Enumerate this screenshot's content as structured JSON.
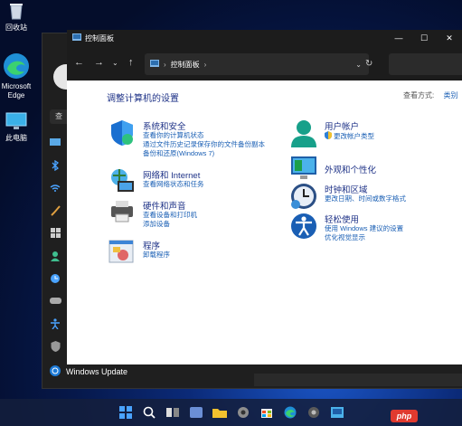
{
  "desktop": {
    "icons": [
      {
        "label": "回收站"
      },
      {
        "label": "Microsoft Edge"
      },
      {
        "label": "此电脑"
      }
    ]
  },
  "settings_window": {
    "search_text": "查",
    "footer_item": "Windows Update"
  },
  "control_panel": {
    "title": "控制面板",
    "address": {
      "crumb": "控制面板"
    },
    "heading": "调整计算机的设置",
    "view_by_label": "查看方式:",
    "view_by_value": "类别",
    "left_categories": [
      {
        "title": "系统和安全",
        "links": [
          "查看你的计算机状态",
          "通过文件历史记录保存你的文件备份副本",
          "备份和还原(Windows 7)"
        ]
      },
      {
        "title": "网络和 Internet",
        "links": [
          "查看网络状态和任务"
        ]
      },
      {
        "title": "硬件和声音",
        "links": [
          "查看设备和打印机",
          "添加设备"
        ]
      },
      {
        "title": "程序",
        "links": [
          "卸载程序"
        ]
      }
    ],
    "right_categories": [
      {
        "title": "用户帐户",
        "links": [
          "更改帐户类型"
        ]
      },
      {
        "title": "外观和个性化",
        "links": []
      },
      {
        "title": "时钟和区域",
        "links": [
          "更改日期、时间或数字格式"
        ]
      },
      {
        "title": "轻松使用",
        "links": [
          "使用 Windows 建议的设置",
          "优化视觉显示"
        ]
      }
    ]
  },
  "watermark": "php"
}
